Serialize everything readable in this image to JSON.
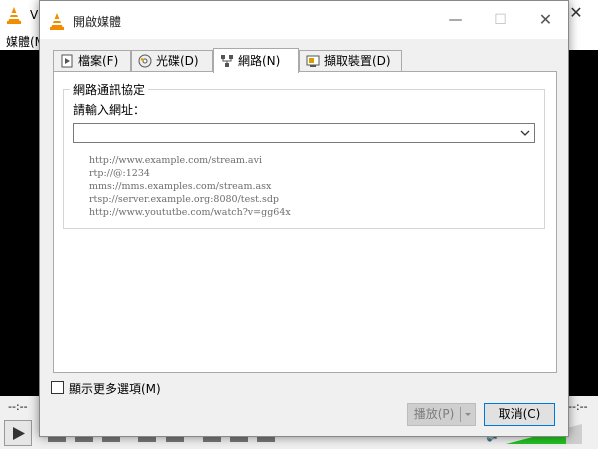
{
  "background_window": {
    "title": "VL",
    "menu_media": "媒體(M)",
    "time_left": "--:--",
    "time_right": "--:--"
  },
  "dialog": {
    "title": "開啟媒體",
    "tabs": [
      {
        "label": "檔案(F)",
        "icon": "file-icon",
        "active": false
      },
      {
        "label": "光碟(D)",
        "icon": "disc-icon",
        "active": false
      },
      {
        "label": "網路(N)",
        "icon": "network-icon",
        "active": true
      },
      {
        "label": "擷取裝置(D)",
        "icon": "capture-device-icon",
        "active": false
      }
    ],
    "network": {
      "group_title": "網路通訊協定",
      "url_label": "請輸入網址：",
      "url_value": "",
      "examples": [
        "http://www.example.com/stream.avi",
        "rtp://@:1234",
        "mms://mms.examples.com/stream.asx",
        "rtsp://server.example.org:8080/test.sdp",
        "http://www.yoututbe.com/watch?v=gg64x"
      ]
    },
    "show_more_options": {
      "label": "顯示更多選項(M)",
      "checked": false
    },
    "play_button": "播放(P)",
    "cancel_button": "取消(C)"
  },
  "colors": {
    "vlc_orange": "#f28c00",
    "video_black": "#000000",
    "focus_blue": "#0078d7",
    "volume_green": "#22c322"
  }
}
